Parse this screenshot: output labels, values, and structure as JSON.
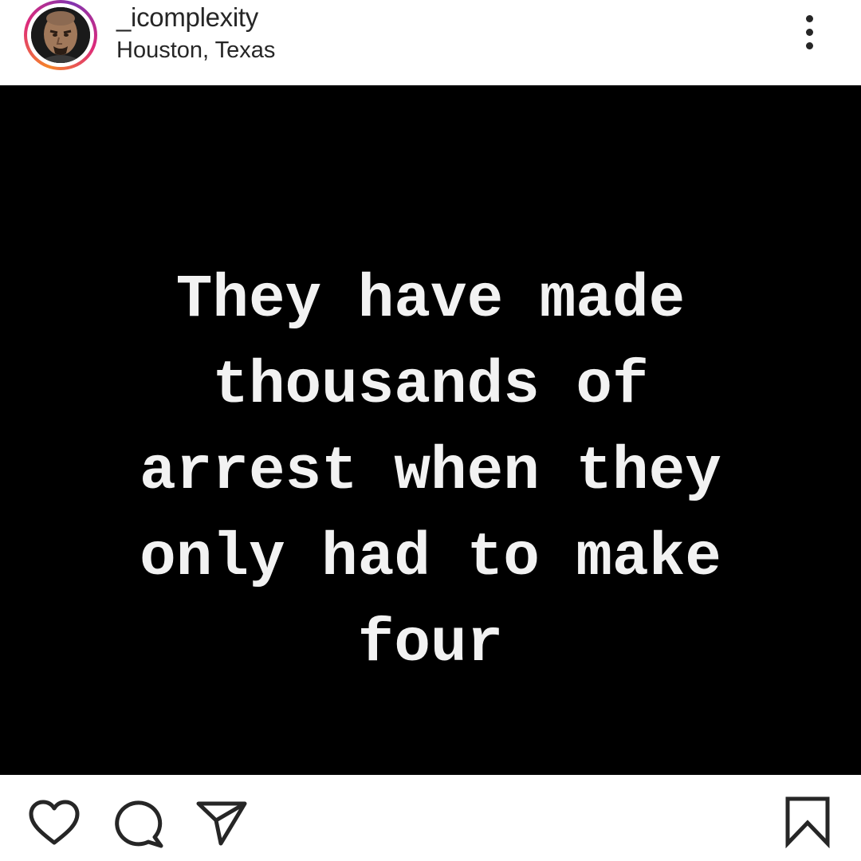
{
  "header": {
    "username": "_icomplexity",
    "location": "Houston, Texas",
    "avatar_icon": "user-avatar",
    "more_icon": "more-vertical-icon"
  },
  "post": {
    "text": "They have made\nthousands of\narrest when they\nonly had to make\nfour",
    "background_color": "#000000",
    "text_color": "#f2f2f2"
  },
  "actions": {
    "like_icon": "heart-icon",
    "comment_icon": "comment-icon",
    "share_icon": "send-icon",
    "save_icon": "bookmark-icon"
  },
  "colors": {
    "ring_gradient": [
      "#f58529",
      "#dd2a7b",
      "#8134af"
    ],
    "icon_color": "#262626"
  }
}
